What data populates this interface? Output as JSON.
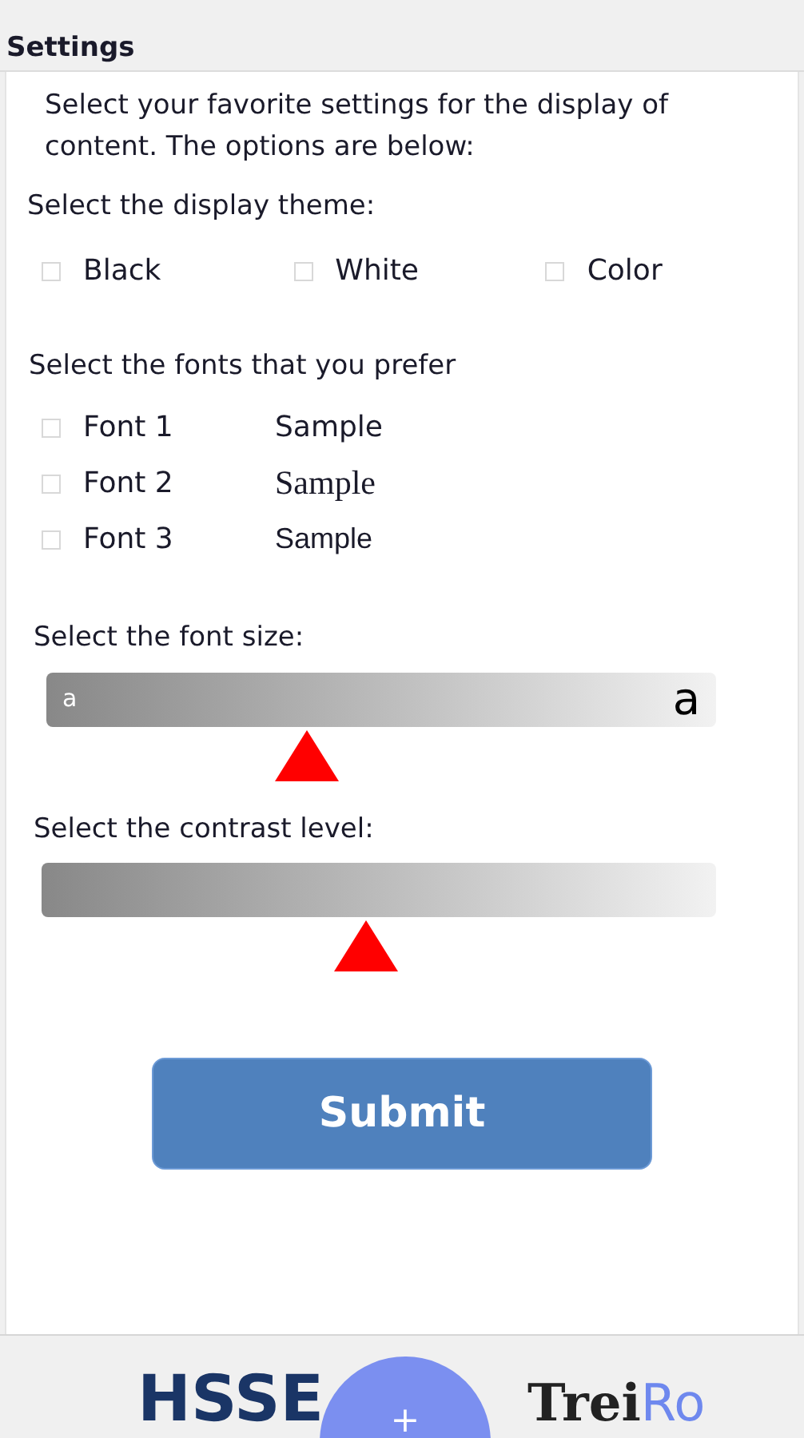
{
  "header": {
    "title": "Settings"
  },
  "intro": "Select your favorite settings for the display of content. The options are below:",
  "theme": {
    "label": "Select the display theme:",
    "options": [
      {
        "label": "Black",
        "checked": false
      },
      {
        "label": "White",
        "checked": false
      },
      {
        "label": "Color",
        "checked": false
      }
    ]
  },
  "fonts": {
    "label": "Select the fonts that you prefer",
    "options": [
      {
        "label": "Font 1",
        "sample": "Sample",
        "kind": "sans",
        "checked": false
      },
      {
        "label": "Font 2",
        "sample": "Sample",
        "kind": "serif",
        "checked": false
      },
      {
        "label": "Font 3",
        "sample": "Sample",
        "kind": "arial",
        "checked": false
      }
    ]
  },
  "font_size": {
    "label": "Select the font size:",
    "min_label": "a",
    "max_label": "a",
    "level": 0.39
  },
  "contrast": {
    "label": "Select the contrast level:",
    "level": 0.48
  },
  "submit": "Submit",
  "footer": {
    "logo_left": "HSSE",
    "fab": "+",
    "logo_right_a": "Trei",
    "logo_right_b": "Ro"
  }
}
